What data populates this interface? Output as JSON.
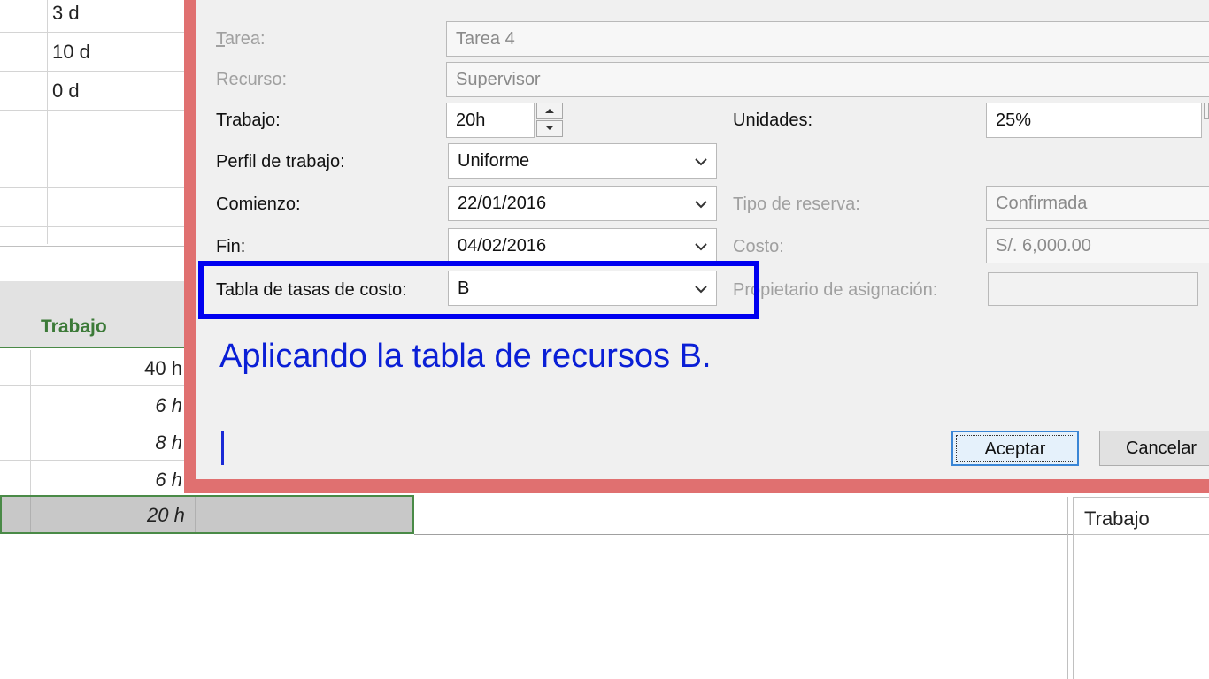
{
  "sheet": {
    "duration_cells": [
      "3 d",
      "10 d",
      "0 d"
    ],
    "column_header": "Trabajo",
    "work_cells": [
      "40 h",
      "6 h",
      "8 h",
      "6 h"
    ],
    "total_work": "20 h",
    "right_panel_label": "Trabajo"
  },
  "dialog": {
    "task": {
      "label": "Tarea:",
      "value": "Tarea 4"
    },
    "resource": {
      "label": "Recurso:",
      "value": "Supervisor"
    },
    "work": {
      "label": "Trabajo:",
      "value": "20h"
    },
    "units": {
      "label": "Unidades:",
      "value": "25%"
    },
    "work_profile": {
      "label": "Perfil de trabajo:",
      "value": "Uniforme"
    },
    "start": {
      "label": "Comienzo:",
      "value": "22/01/2016"
    },
    "booking_type": {
      "label": "Tipo de reserva:",
      "value": "Confirmada"
    },
    "finish": {
      "label": "Fin:",
      "value": "04/02/2016"
    },
    "cost": {
      "label": "Costo:",
      "value": "S/. 6,000.00"
    },
    "cost_rate_table": {
      "label": "Tabla de tasas de costo:",
      "value": "B"
    },
    "assignment_owner": {
      "label": "Propietario de asignación:",
      "value": ""
    },
    "ok_label": "Aceptar",
    "cancel_label": "Cancelar"
  },
  "annotation": "Aplicando la tabla de recursos B.",
  "colors": {
    "highlight": "#0000f0",
    "annotation": "#0a1fd6",
    "dialog_border": "#e07070",
    "header_green": "#3c7a38"
  }
}
